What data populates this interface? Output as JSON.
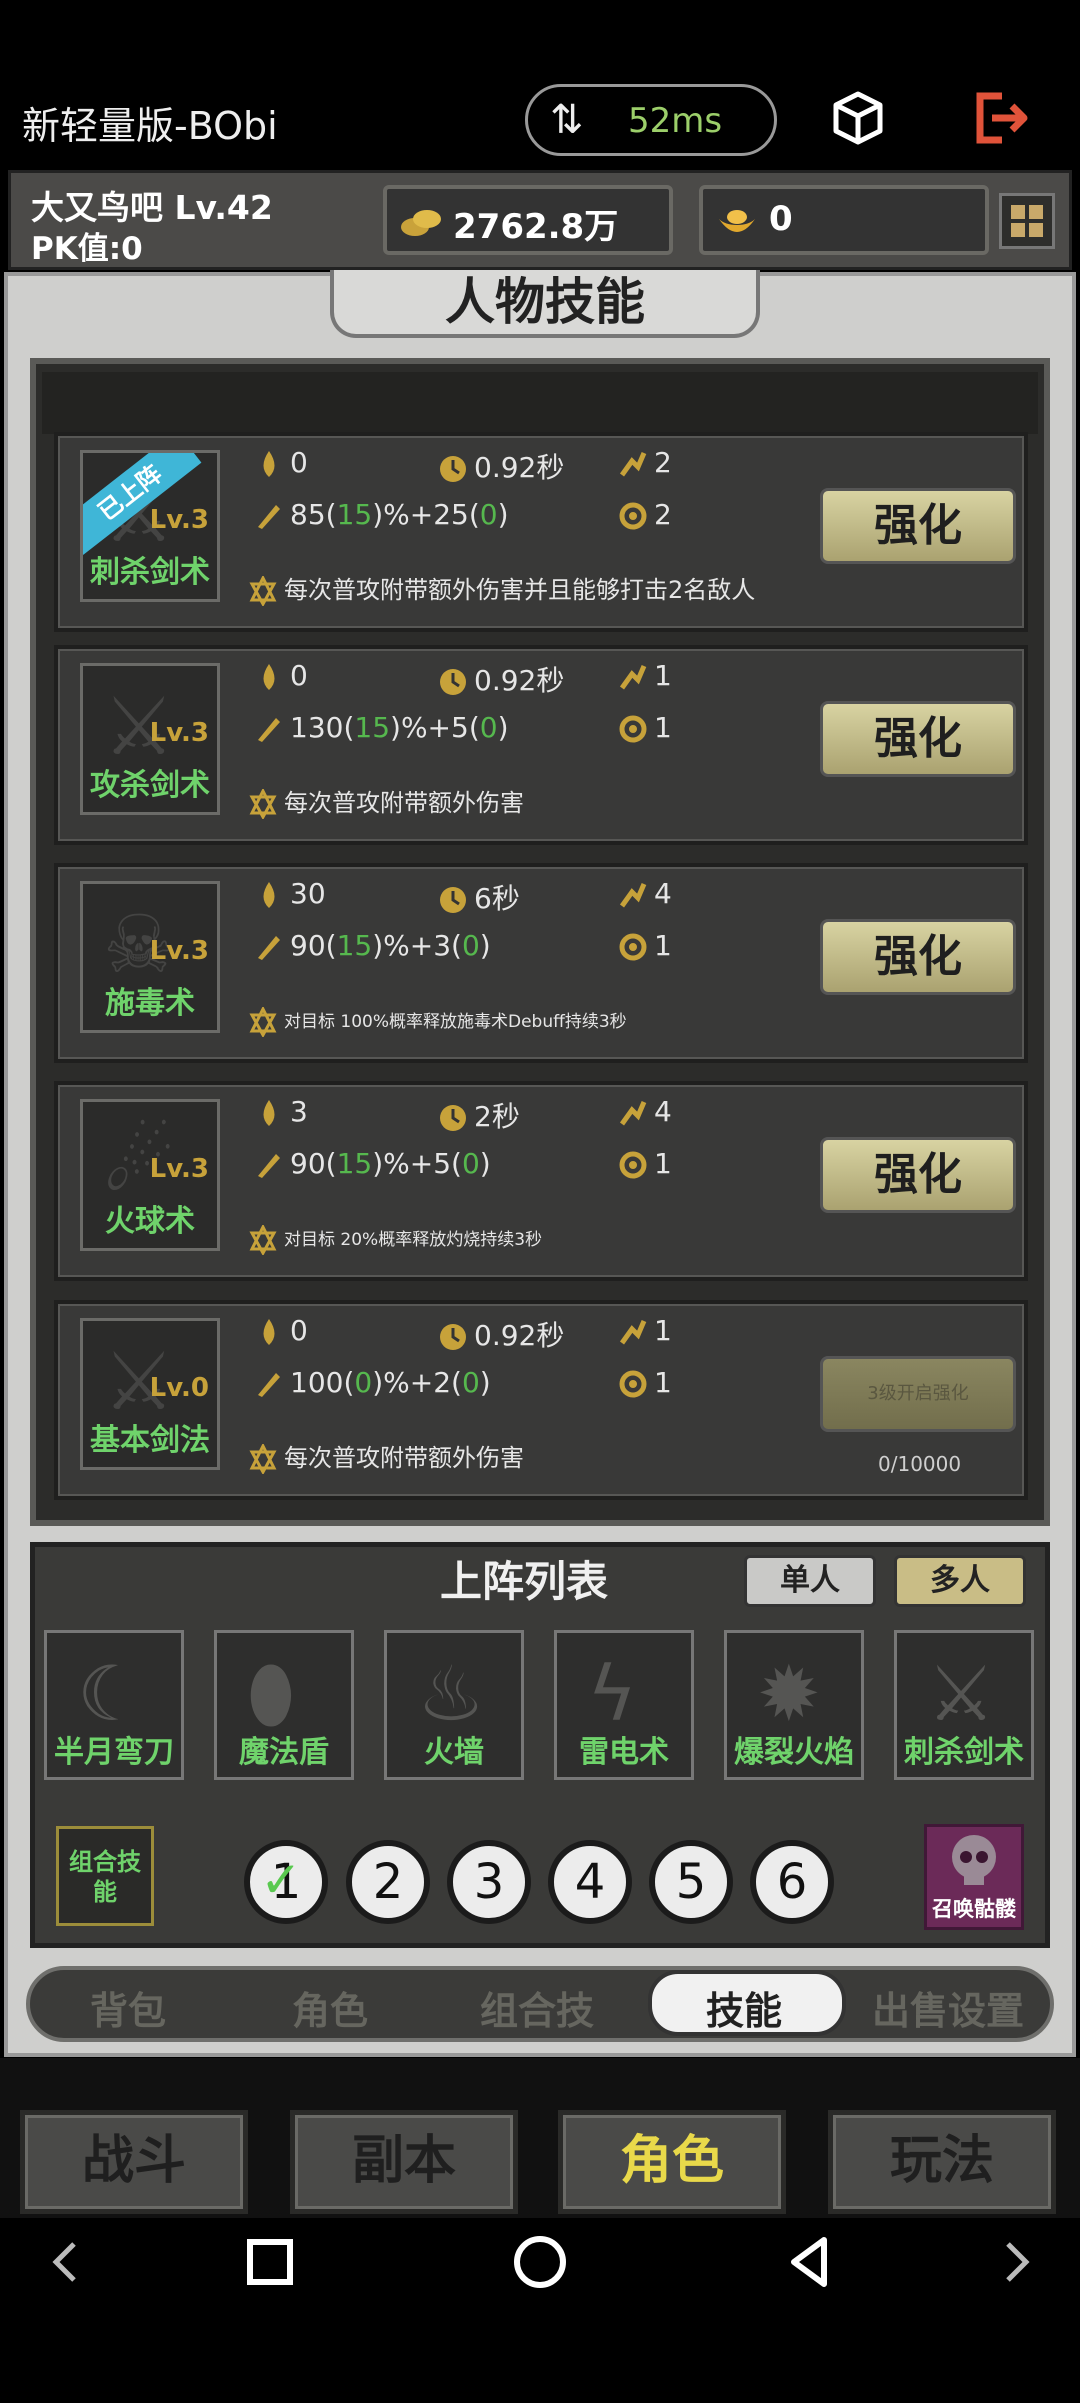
{
  "status": {
    "app_title": "新轻量版-BObi",
    "ping": "52ms"
  },
  "player": {
    "name_level": "大又鸟吧  Lv.42",
    "pk": "PK值:0",
    "gold": "2762.8万",
    "ingot": "0"
  },
  "section_title": "人物技能",
  "skills": [
    {
      "name": "刺杀剑术",
      "level": "Lv.3",
      "badge": "已上阵",
      "mp": "0",
      "cooldown": "0.92秒",
      "range": "2",
      "dmg_a": "85(",
      "dmg_b": "15",
      "dmg_c": ")%+25(",
      "dmg_d": "0",
      "dmg_e": ")",
      "targets": "2",
      "desc": "每次普攻附带额外伤害并且能够打击2名敌人",
      "button": "强化"
    },
    {
      "name": "攻杀剑术",
      "level": "Lv.3",
      "mp": "0",
      "cooldown": "0.92秒",
      "range": "1",
      "dmg_a": "130(",
      "dmg_b": "15",
      "dmg_c": ")%+5(",
      "dmg_d": "0",
      "dmg_e": ")",
      "targets": "1",
      "desc": "每次普攻附带额外伤害",
      "button": "强化"
    },
    {
      "name": "施毒术",
      "level": "Lv.3",
      "mp": "30",
      "cooldown": "6秒",
      "range": "4",
      "dmg_a": "90(",
      "dmg_b": "15",
      "dmg_c": ")%+3(",
      "dmg_d": "0",
      "dmg_e": ")",
      "targets": "1",
      "desc": "对目标 100%概率释放施毒术Debuff持续3秒",
      "button": "强化"
    },
    {
      "name": "火球术",
      "level": "Lv.3",
      "mp": "3",
      "cooldown": "2秒",
      "range": "4",
      "dmg_a": "90(",
      "dmg_b": "15",
      "dmg_c": ")%+5(",
      "dmg_d": "0",
      "dmg_e": ")",
      "targets": "1",
      "desc": "对目标 20%概率释放灼烧持续3秒",
      "button": "强化"
    },
    {
      "name": "基本剑法",
      "level": "Lv.0",
      "mp": "0",
      "cooldown": "0.92秒",
      "range": "1",
      "dmg_a": "100(",
      "dmg_b": "0",
      "dmg_c": ")%+2(",
      "dmg_d": "0",
      "dmg_e": ")",
      "targets": "1",
      "desc": "每次普攻附带额外伤害",
      "button": "3级开启强化",
      "exp": "0/10000"
    }
  ],
  "deploy": {
    "title": "上阵列表",
    "mode_single": "单人",
    "mode_multi": "多人",
    "slots": [
      "半月弯刀",
      "魔法盾",
      "火墙",
      "雷电术",
      "爆裂火焰",
      "刺杀剑术"
    ],
    "combo_label": "组合技能",
    "numbers": [
      "1",
      "2",
      "3",
      "4",
      "5",
      "6"
    ],
    "summon_label": "召唤骷髅"
  },
  "subtabs": [
    "背包",
    "角色",
    "组合技",
    "技能",
    "出售设置"
  ],
  "nav": [
    "战斗",
    "副本",
    "角色",
    "玩法"
  ],
  "colors": {
    "accent_green": "#6fd36b",
    "gold_text": "#e9d94a",
    "badge_blue": "#3fb6d7",
    "ping_green": "#9ccf6a",
    "exit_red": "#e0533a"
  }
}
